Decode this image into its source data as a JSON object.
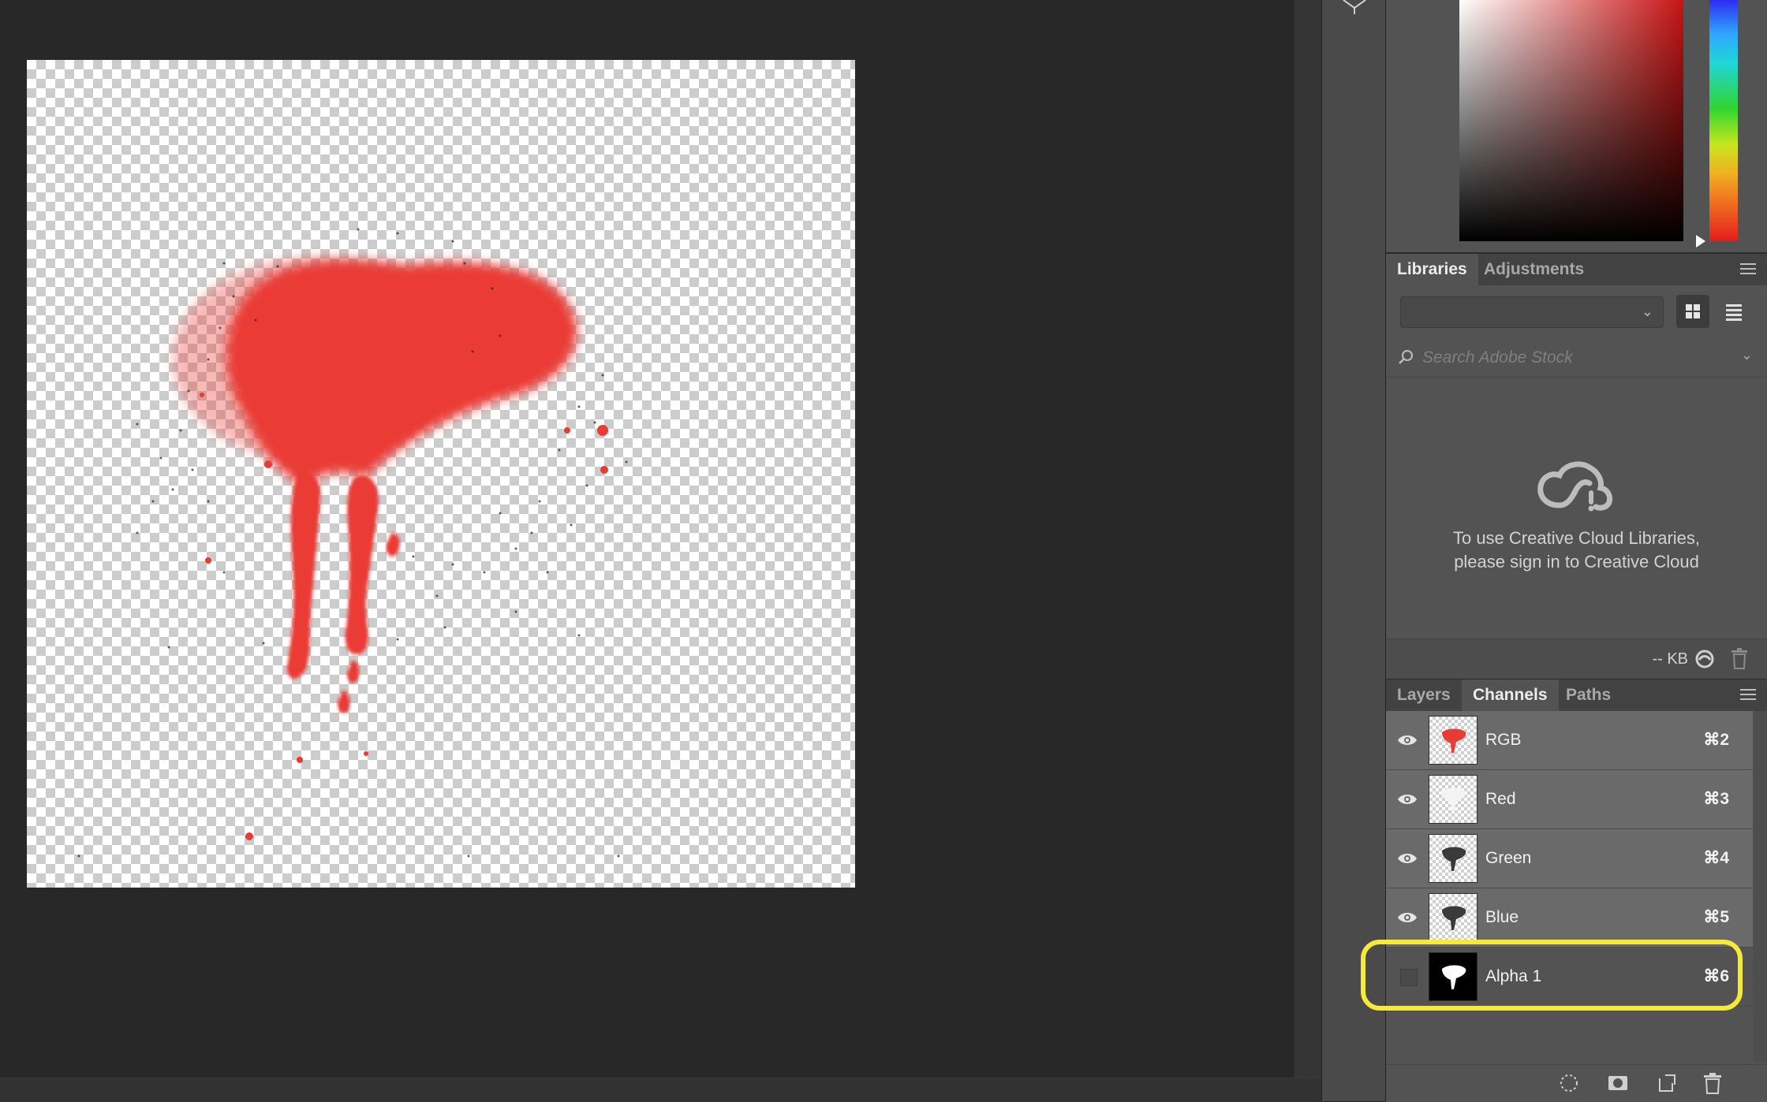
{
  "colors": {
    "accent_highlight": "#f5ea3a",
    "splatter": "#ea3a34",
    "workspace": "#282828",
    "panel": "#535353"
  },
  "libraries_panel": {
    "tabs": [
      "Libraries",
      "Adjustments"
    ],
    "active_tab": "Libraries",
    "library_select_value": "",
    "search_placeholder": "Search Adobe Stock",
    "message_line1": "To use Creative Cloud Libraries,",
    "message_line2": "please sign in to Creative Cloud",
    "storage_label": "-- KB",
    "icons": [
      "grid-view-icon",
      "list-view-icon",
      "search-icon",
      "creative-cloud-icon",
      "sync-icon",
      "trash-icon",
      "panel-menu-icon"
    ]
  },
  "channels_panel": {
    "tabs": [
      "Layers",
      "Channels",
      "Paths"
    ],
    "active_tab": "Channels",
    "channels": [
      {
        "name": "RGB",
        "shortcut": "⌘2",
        "visible": true
      },
      {
        "name": "Red",
        "shortcut": "⌘3",
        "visible": true
      },
      {
        "name": "Green",
        "shortcut": "⌘4",
        "visible": true
      },
      {
        "name": "Blue",
        "shortcut": "⌘5",
        "visible": true
      },
      {
        "name": "Alpha 1",
        "shortcut": "⌘6",
        "visible": false,
        "highlighted": true
      }
    ],
    "footer_icons": [
      "load-channel-as-selection-icon",
      "save-selection-as-channel-icon",
      "new-channel-icon",
      "delete-channel-icon"
    ]
  }
}
